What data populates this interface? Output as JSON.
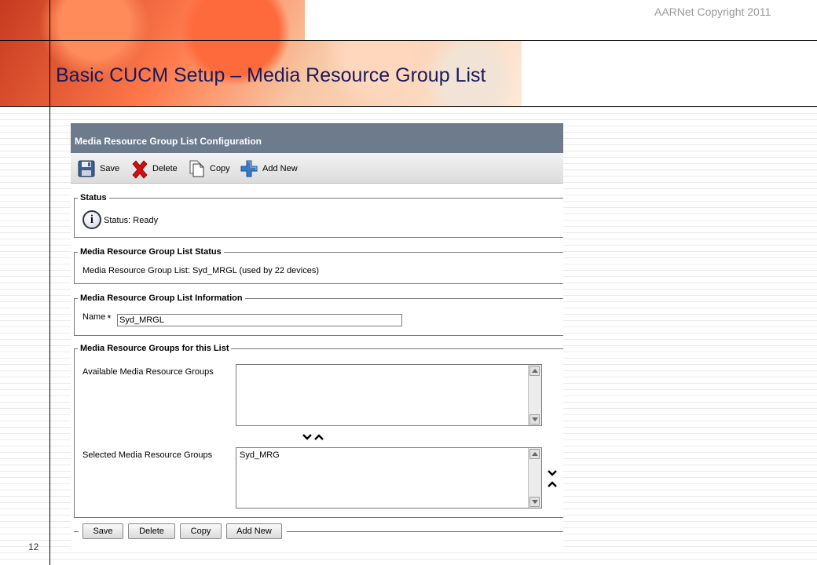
{
  "slide": {
    "copyright": "AARNet Copyright 2011",
    "title": "Basic CUCM Setup – Media Resource Group List",
    "page_number": "12"
  },
  "panel": {
    "title": "Media Resource Group List Configuration",
    "toolbar": {
      "save": "Save",
      "delete": "Delete",
      "copy": "Copy",
      "add_new": "Add New"
    },
    "status": {
      "legend": "Status",
      "text": "Status: Ready"
    },
    "list_status": {
      "legend": "Media Resource Group List Status",
      "text": "Media Resource Group List: Syd_MRGL (used by 22 devices)"
    },
    "information": {
      "legend": "Media Resource Group List Information",
      "name_label": "Name",
      "required_mark": "*",
      "name_value": "Syd_MRGL"
    },
    "groups": {
      "legend": "Media Resource Groups for this List",
      "available_label": "Available Media Resource Groups",
      "available_items": [],
      "selected_label": "Selected Media Resource Groups",
      "selected_items": [
        "Syd_MRG"
      ]
    },
    "bottom_buttons": {
      "save": "Save",
      "delete": "Delete",
      "copy": "Copy",
      "add_new": "Add New"
    }
  },
  "icons": [
    "save-icon",
    "delete-icon",
    "copy-icon",
    "add-new-icon",
    "info-icon",
    "chevron-down-icon",
    "chevron-up-icon"
  ],
  "colors": {
    "header_bg": "#6d7b8d",
    "title_text": "#1a1a5a",
    "delete_red": "#d01010",
    "add_blue": "#3a78c8"
  }
}
